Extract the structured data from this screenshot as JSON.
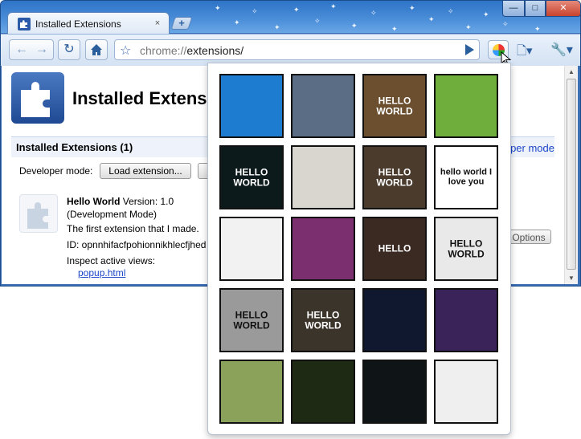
{
  "browser": {
    "tab_title": "Installed Extensions",
    "tab_close": "×",
    "new_tab": "+",
    "url_scheme": "chrome://",
    "url_path": "extensions/",
    "window_controls": {
      "minimize": "—",
      "maximize": "□",
      "close": "✕"
    },
    "icons": {
      "back": "back-arrow-icon",
      "forward": "forward-arrow-icon",
      "reload": "reload-icon",
      "home": "home-icon",
      "star": "bookmark-star-icon",
      "go": "go-arrow-icon",
      "extension": "extension-ball-icon",
      "page": "page-menu-icon",
      "wrench": "wrench-menu-icon"
    }
  },
  "page": {
    "heading": "Installed Extensions",
    "section_title": "Installed Extensions (1)",
    "developer_mode_link": "per mode",
    "developer_mode_label": "Developer mode:",
    "load_extension_button": "Load extension...",
    "extension": {
      "name": "Hello World",
      "version": " Version: 1.0",
      "mode": "(Development Mode)",
      "description": "The first extension that I made.",
      "id": "ID: opnnhifacfpohionnikhlecfjhed",
      "inspect_label": "Inspect active views:",
      "popup_link": "popup.html",
      "options_button": "Options"
    }
  },
  "popup": {
    "photos": [
      {
        "bg": "#1d7bd0",
        "cap": ""
      },
      {
        "bg": "#5a6d84",
        "cap": ""
      },
      {
        "bg": "#6b4f2f",
        "cap": "HELLO WORLD"
      },
      {
        "bg": "#6fae3c",
        "cap": ""
      },
      {
        "bg": "#0d1a1c",
        "cap": "HELLO WORLD"
      },
      {
        "bg": "#d9d6cf",
        "cap": ""
      },
      {
        "bg": "#4a3b2d",
        "cap": "HELLO WORLD"
      },
      {
        "bg": "#ffffff",
        "cap": "hello world I love you"
      },
      {
        "bg": "#f2f2f2",
        "cap": ""
      },
      {
        "bg": "#7b2f6e",
        "cap": ""
      },
      {
        "bg": "#3a2a22",
        "cap": "HELLO"
      },
      {
        "bg": "#e9e9e9",
        "cap": "HELLO WORLD"
      },
      {
        "bg": "#9a9a9a",
        "cap": "HELLO WORLD"
      },
      {
        "bg": "#3b342b",
        "cap": "HELLO WORLD"
      },
      {
        "bg": "#101830",
        "cap": ""
      },
      {
        "bg": "#3a2358",
        "cap": ""
      },
      {
        "bg": "#8aa25a",
        "cap": ""
      },
      {
        "bg": "#1f2a14",
        "cap": ""
      },
      {
        "bg": "#0f1416",
        "cap": ""
      },
      {
        "bg": "#efefef",
        "cap": ""
      }
    ]
  }
}
